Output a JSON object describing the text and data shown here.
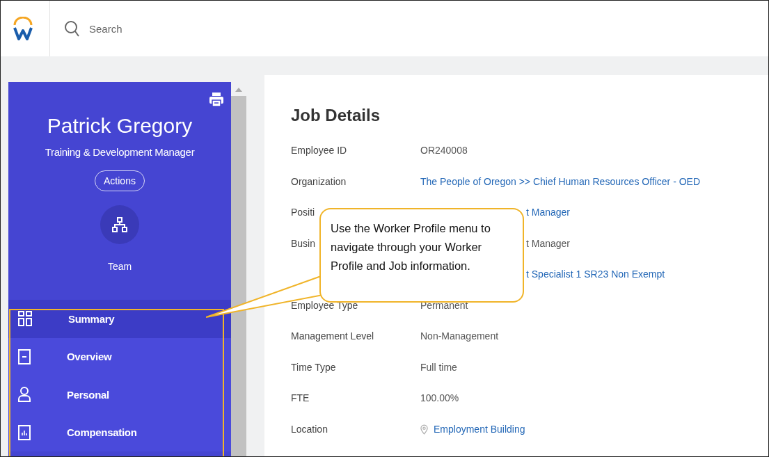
{
  "search": {
    "placeholder": "Search"
  },
  "profile": {
    "name": "Patrick Gregory",
    "title": "Training & Development Manager",
    "actions_button": "Actions",
    "team_label": "Team"
  },
  "nav": [
    {
      "label": "Summary",
      "selected": true
    },
    {
      "label": "Overview",
      "selected": false
    },
    {
      "label": "Personal",
      "selected": false
    },
    {
      "label": "Compensation",
      "selected": false
    }
  ],
  "job_details": {
    "title": "Job Details",
    "rows": [
      {
        "label": "Employee ID",
        "value": "OR240008",
        "kind": "text"
      },
      {
        "label": "Organization",
        "value": "The People of Oregon >> Chief Human Resources Officer - OED",
        "kind": "link"
      },
      {
        "label": "Positi",
        "value": "t Manager",
        "kind": "link",
        "covered": true
      },
      {
        "label": "Busin",
        "value": "t Manager",
        "kind": "text",
        "covered": true
      },
      {
        "value": "t Specialist 1 SR23 Non Exempt",
        "kind": "link",
        "covered": true
      },
      {
        "label": "Employee Type",
        "value": "Permanent",
        "kind": "text"
      },
      {
        "label": "Management Level",
        "value": "Non-Management",
        "kind": "text"
      },
      {
        "label": "Time Type",
        "value": "Full time",
        "kind": "text"
      },
      {
        "label": "FTE",
        "value": "100.00%",
        "kind": "text"
      },
      {
        "label": "Location",
        "value": "Employment Building",
        "kind": "location"
      }
    ]
  },
  "callout": {
    "text": "Use the Worker Profile menu to navigate through your Worker Profile and Job information."
  }
}
